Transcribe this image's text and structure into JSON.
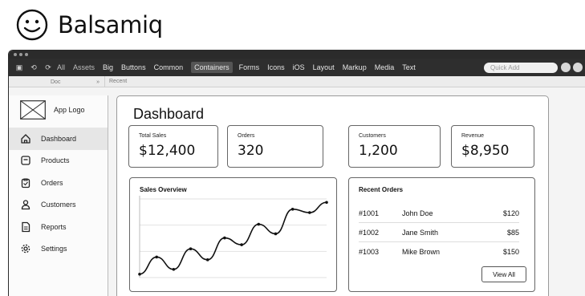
{
  "brand": {
    "name": "Balsamiq"
  },
  "toolbar": {
    "icons": [
      "window-icon",
      "undo-icon",
      "redo-icon"
    ],
    "items": [
      "All",
      "Assets",
      "Big",
      "Buttons",
      "Common",
      "Containers",
      "Forms",
      "Icons",
      "iOS",
      "Layout",
      "Markup",
      "Media",
      "Text"
    ],
    "active_item": "Containers",
    "quick_add_placeholder": "Quick Add"
  },
  "subbar": {
    "left_tab": "Doc",
    "collapse_glyph": "»",
    "breadcrumb": "Recent"
  },
  "sidebar": {
    "logo_label": "App Logo",
    "items": [
      {
        "label": "Dashboard",
        "icon": "home-icon",
        "active": true
      },
      {
        "label": "Products",
        "icon": "box-icon",
        "active": false
      },
      {
        "label": "Orders",
        "icon": "clipboard-icon",
        "active": false
      },
      {
        "label": "Customers",
        "icon": "user-icon",
        "active": false
      },
      {
        "label": "Reports",
        "icon": "document-icon",
        "active": false
      },
      {
        "label": "Settings",
        "icon": "gear-icon",
        "active": false
      }
    ]
  },
  "main": {
    "title": "Dashboard",
    "kpis": [
      {
        "label": "Total Sales",
        "value": "$12,400"
      },
      {
        "label": "Orders",
        "value": "320"
      },
      {
        "label": "Customers",
        "value": "1,200"
      },
      {
        "label": "Revenue",
        "value": "$8,950"
      }
    ],
    "sales_panel": {
      "title": "Sales Overview"
    },
    "orders_panel": {
      "title": "Recent Orders",
      "rows": [
        {
          "id": "#1001",
          "name": "John Doe",
          "amount": "$120"
        },
        {
          "id": "#1002",
          "name": "Jane Smith",
          "amount": "$85"
        },
        {
          "id": "#1003",
          "name": "Mike Brown",
          "amount": "$150"
        }
      ],
      "button_label": "View All"
    }
  },
  "chart_data": {
    "type": "line",
    "title": "Sales Overview",
    "xlabel": "",
    "ylabel": "",
    "grid": true,
    "series": [
      {
        "values": [
          5,
          30,
          12,
          42,
          26,
          58,
          48,
          78,
          64,
          100,
          95,
          110
        ]
      }
    ],
    "ylim": [
      0,
      115
    ]
  }
}
